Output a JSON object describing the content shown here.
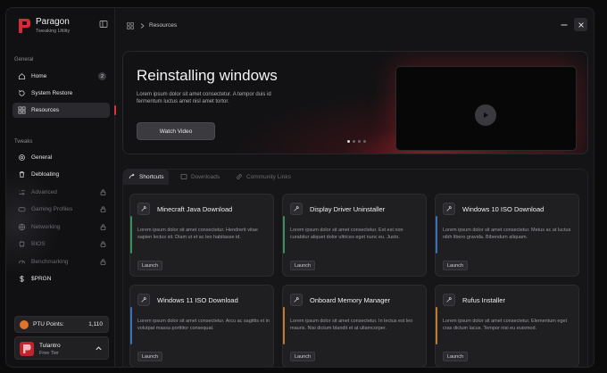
{
  "app": {
    "title": "Paragon",
    "subtitle": "Tweaking Utility"
  },
  "sidebar": {
    "section_general": "General",
    "section_tweaks": "Tweaks",
    "general_items": [
      {
        "label": "Home",
        "badge": "2"
      },
      {
        "label": "System Restore"
      },
      {
        "label": "Resources"
      }
    ],
    "tweak_items": [
      {
        "label": "General"
      },
      {
        "label": "Debloating"
      },
      {
        "label": "Advanced"
      },
      {
        "label": "Gaming Profiles"
      },
      {
        "label": "Networking"
      },
      {
        "label": "BIOS"
      },
      {
        "label": "Benchmarking"
      },
      {
        "label": "$PRGN"
      }
    ],
    "points": {
      "label": "PTU Points:",
      "value": "1,110"
    },
    "user": {
      "name": "Tulantro",
      "tier": "Free Tier"
    }
  },
  "topbar": {
    "breadcrumb": "Resources"
  },
  "hero": {
    "title": "Reinstalling windows",
    "description": "Lorem ipsum dolor sit amet consectetur. A tempor duis id fermentum luctus amet nisl amet tortor.",
    "button": "Watch Video"
  },
  "tabs": [
    {
      "label": "Shortcuts"
    },
    {
      "label": "Downloads"
    },
    {
      "label": "Community Links"
    }
  ],
  "cards": [
    {
      "title": "Minecraft Java Download",
      "description": "Lorem ipsum dolor sit amet consectetur. Hendrerit vitae sapien lectus sit. Diam ut et ac leo habitasse id.",
      "button": "Launch",
      "accent": "#3a8f5a"
    },
    {
      "title": "Display Driver Uninstaller",
      "description": "Lorem ipsum dolor sit amet consectetur. Est est non curabitur aliquet dolor ultrices eget nunc eu. Justo.",
      "button": "Launch",
      "accent": "#3a8f5a"
    },
    {
      "title": "Windows 10 ISO Download",
      "description": "Lorem ipsum dolor sit amet consectetur. Metus ac at luctus nibh libero gravida. Bibendum aliquam.",
      "button": "Launch",
      "accent": "#3b6fb8"
    },
    {
      "title": "Windows 11 ISO Download",
      "description": "Lorem ipsum dolor sit amet consectetur. Arcu ac sagittis et in volutpat massa porttitor consequat.",
      "button": "Launch",
      "accent": "#3b6fb8"
    },
    {
      "title": "Onboard Memory Manager",
      "description": "Lorem ipsum dolor sit amet consectetur. In lectus est leo mauris. Nisi dictum blandit et at ullamcorper.",
      "button": "Launch",
      "accent": "#c07a2a"
    },
    {
      "title": "Rufus Installer",
      "description": "Lorem ipsum dolor sit amet consectetur. Elementum eget cras dictum lacus. Tempor nisi eu euismod.",
      "button": "Launch",
      "accent": "#c07a2a"
    }
  ]
}
